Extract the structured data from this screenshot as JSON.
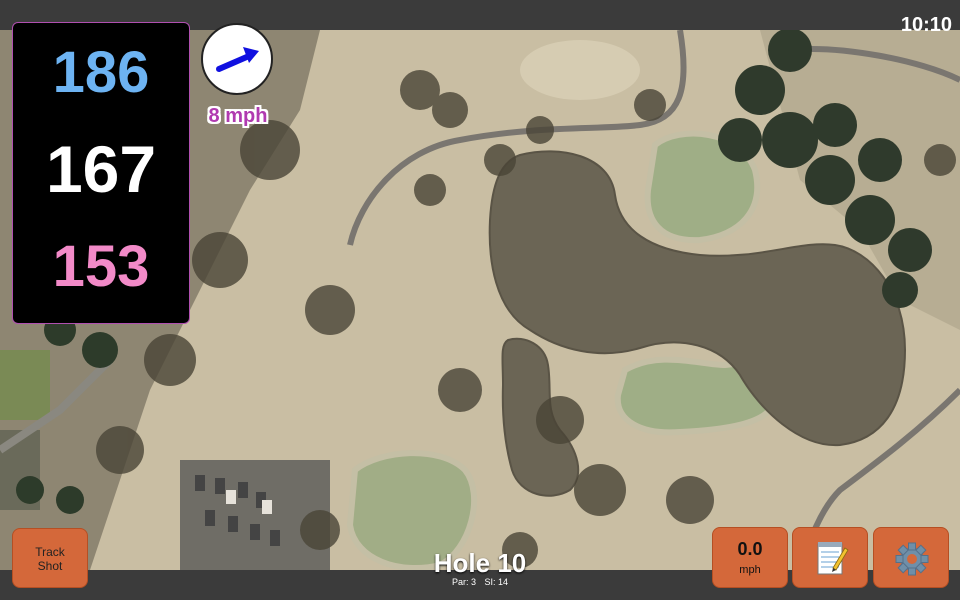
{
  "status_bar": {
    "time": "10:10"
  },
  "yardage": {
    "back": "186",
    "middle": "167",
    "front": "153",
    "colors": {
      "back": "#6db3f2",
      "middle": "#ffffff",
      "front": "#f28ac8"
    }
  },
  "wind": {
    "speed_label": "8 mph",
    "arrow_icon": "wind-direction-arrow-icon",
    "arrow_color": "#1010e0",
    "speed_color": "#b03ab0"
  },
  "buttons": {
    "track_shot": {
      "line1": "Track",
      "line2": "Shot"
    },
    "speed": {
      "value": "0.0",
      "unit": "mph"
    },
    "notes_icon": "notepad-icon",
    "settings_icon": "gear-icon",
    "accent": "#d4683a"
  },
  "hole": {
    "title": "Hole 10",
    "par_label": "Par: 3",
    "si_label": "SI: 14"
  }
}
